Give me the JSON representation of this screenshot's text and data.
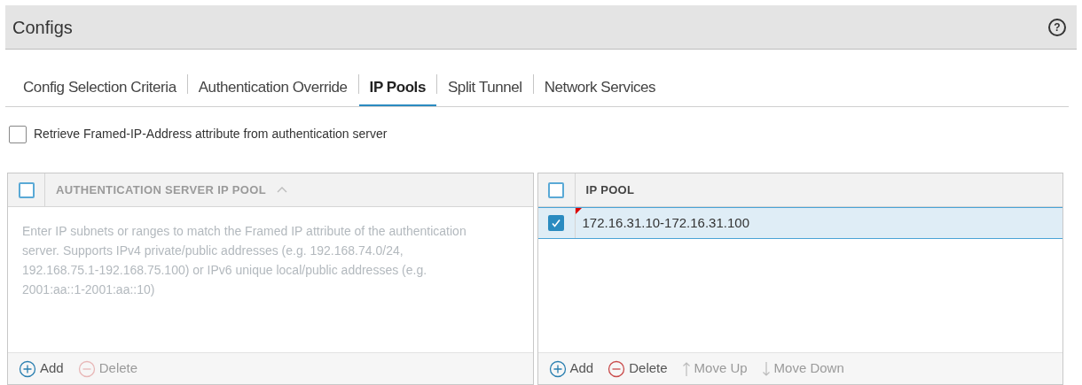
{
  "header": {
    "title": "Configs",
    "help": "?"
  },
  "tabs": [
    {
      "label": "Config Selection Criteria",
      "selected": false
    },
    {
      "label": "Authentication Override",
      "selected": false
    },
    {
      "label": "IP Pools",
      "selected": true
    },
    {
      "label": "Split Tunnel",
      "selected": false
    },
    {
      "label": "Network Services",
      "selected": false
    }
  ],
  "retrieve_option": {
    "label": "Retrieve Framed-IP-Address attribute from authentication server",
    "checked": false
  },
  "panels": [
    {
      "column": "AUTHENTICATION SERVER IP POOL",
      "sorted": true,
      "select_all": false,
      "placeholder": "Enter IP subnets or ranges to match the Framed IP attribute of the authentication server. Supports IPv4 private/public addresses (e.g. 192.168.74.0/24, 192.168.75.1-192.168.75.100) or IPv6 unique local/public addresses (e.g. 2001:aa::1-2001:aa::10)",
      "actions": [
        {
          "kind": "add",
          "label": "Add",
          "disabled": false
        },
        {
          "kind": "delete",
          "label": "Delete",
          "disabled": true
        }
      ]
    },
    {
      "column": "IP POOL",
      "sorted": false,
      "select_all": false,
      "rows": [
        {
          "value": "172.16.31.10-172.16.31.100",
          "checked": true,
          "selected": true
        }
      ],
      "actions": [
        {
          "kind": "add",
          "label": "Add",
          "disabled": false
        },
        {
          "kind": "delete",
          "label": "Delete",
          "disabled": false
        },
        {
          "kind": "up",
          "label": "Move Up",
          "disabled": true
        },
        {
          "kind": "down",
          "label": "Move Down",
          "disabled": true
        }
      ]
    }
  ]
}
